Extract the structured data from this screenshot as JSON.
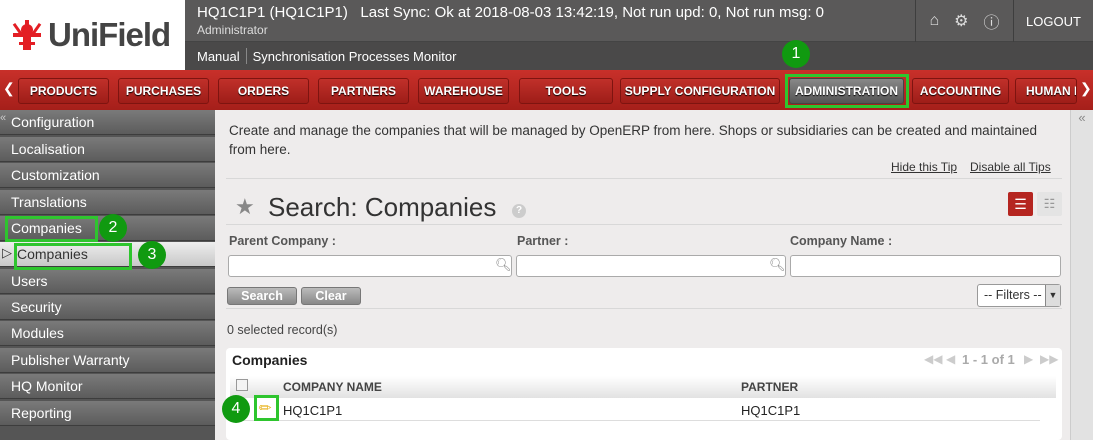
{
  "header": {
    "logo_text": "UniField",
    "title": "HQ1C1P1 (HQ1C1P1)   Last Sync: Ok at 2018-08-03 13:42:19, Not run upd: 0, Not run msg: 0",
    "user": "Administrator",
    "logout_label": "LOGOUT",
    "icons": [
      "home-icon",
      "gear-icon",
      "info-icon"
    ],
    "shortcuts": [
      "Manual",
      "Synchronisation Processes Monitor"
    ]
  },
  "menu": {
    "items": [
      "PRODUCTS",
      "PURCHASES",
      "ORDERS",
      "PARTNERS",
      "WAREHOUSE",
      "TOOLS",
      "SUPPLY CONFIGURATION",
      "ADMINISTRATION",
      "ACCOUNTING",
      "HUMAN R"
    ],
    "active": "ADMINISTRATION"
  },
  "sidebar": {
    "items": [
      "Configuration",
      "Localisation",
      "Customization",
      "Translations",
      "Companies",
      "Companies",
      "Users",
      "Security",
      "Modules",
      "Publisher Warranty",
      "HQ Monitor",
      "Reporting"
    ]
  },
  "tip": {
    "text": "Create and manage the companies that will be managed by OpenERP from here. Shops or subsidiaries can be created and maintained from here.",
    "hide": "Hide this Tip",
    "disable": "Disable all Tips"
  },
  "search": {
    "title": "Search: Companies",
    "help": "?",
    "fields": [
      {
        "label": "Parent Company :",
        "value": ""
      },
      {
        "label": "Partner :",
        "value": ""
      },
      {
        "label": "Company Name :",
        "value": ""
      }
    ],
    "search_label": "Search",
    "clear_label": "Clear",
    "filters_label": "-- Filters --"
  },
  "list": {
    "selected": "0 selected record(s)",
    "title": "Companies",
    "pager": "1 - 1 of 1",
    "columns": [
      "COMPANY NAME",
      "PARTNER"
    ],
    "rows": [
      {
        "company": "HQ1C1P1",
        "partner": "HQ1C1P1"
      }
    ]
  },
  "annotations": [
    "1",
    "2",
    "3",
    "4"
  ],
  "colors": {
    "accent": "#b52520",
    "highlight": "#2ec52e",
    "badge": "#109a10"
  }
}
